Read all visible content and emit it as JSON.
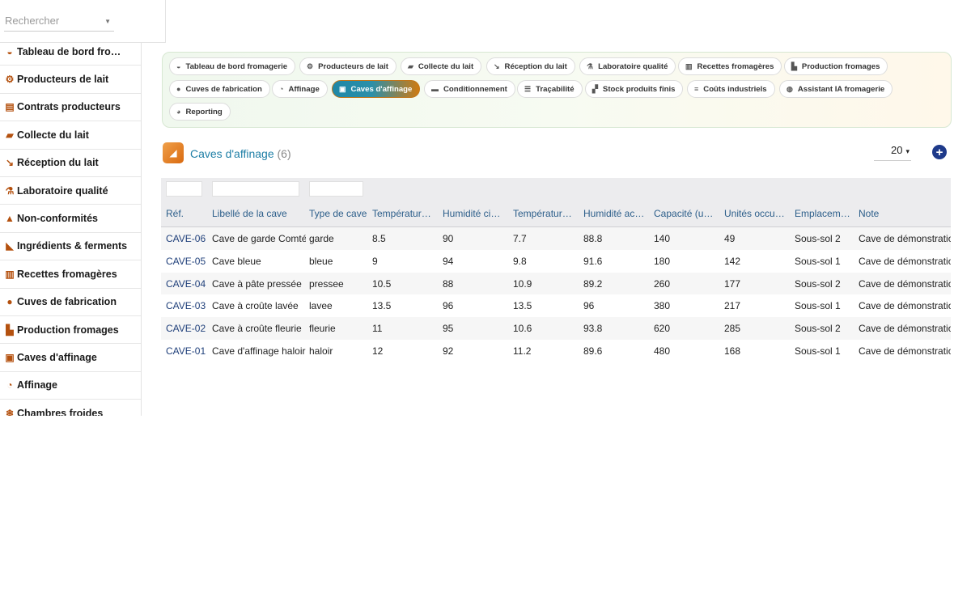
{
  "search": {
    "placeholder": "Rechercher"
  },
  "sidebar": {
    "items": [
      {
        "label": "Tableau de bord fro…",
        "icon": "gauge-icon"
      },
      {
        "label": "Producteurs de lait",
        "icon": "tractor-icon"
      },
      {
        "label": "Contrats producteurs",
        "icon": "file-contract-icon"
      },
      {
        "label": "Collecte du lait",
        "icon": "truck-icon"
      },
      {
        "label": "Réception du lait",
        "icon": "dolly-icon"
      },
      {
        "label": "Laboratoire qualité",
        "icon": "microscope-icon"
      },
      {
        "label": "Non-conformités",
        "icon": "warning-icon"
      },
      {
        "label": "Ingrédients & ferments",
        "icon": "mortar-icon"
      },
      {
        "label": "Recettes fromagères",
        "icon": "book-icon"
      },
      {
        "label": "Cuves de fabrication",
        "icon": "droplet-icon"
      },
      {
        "label": "Production fromages",
        "icon": "industry-icon"
      },
      {
        "label": "Caves d'affinage",
        "icon": "cave-icon"
      },
      {
        "label": "Affinage",
        "icon": "clock-icon"
      },
      {
        "label": "Chambres froides",
        "icon": "snowflake-icon"
      }
    ]
  },
  "tabs": [
    {
      "label": "Tableau de bord fromagerie",
      "icon": "gauge-icon",
      "active": false
    },
    {
      "label": "Producteurs de lait",
      "icon": "tractor-icon",
      "active": false
    },
    {
      "label": "Collecte du lait",
      "icon": "truck-icon",
      "active": false
    },
    {
      "label": "Réception du lait",
      "icon": "dolly-icon",
      "active": false
    },
    {
      "label": "Laboratoire qualité",
      "icon": "microscope-icon",
      "active": false
    },
    {
      "label": "Recettes fromagères",
      "icon": "book-icon",
      "active": false
    },
    {
      "label": "Production fromages",
      "icon": "industry-icon",
      "active": false
    },
    {
      "label": "Cuves de fabrication",
      "icon": "droplet-icon",
      "active": false
    },
    {
      "label": "Affinage",
      "icon": "clock-icon",
      "active": false
    },
    {
      "label": "Caves d'affinage",
      "icon": "cave-icon",
      "active": true
    },
    {
      "label": "Conditionnement",
      "icon": "box-icon",
      "active": false
    },
    {
      "label": "Traçabilité",
      "icon": "barcode-icon",
      "active": false
    },
    {
      "label": "Stock produits finis",
      "icon": "boxes-icon",
      "active": false
    },
    {
      "label": "Coûts industriels",
      "icon": "coins-icon",
      "active": false
    },
    {
      "label": "Assistant IA fromagerie",
      "icon": "brain-icon",
      "active": false
    },
    {
      "label": "Reporting",
      "icon": "chart-pie-icon",
      "active": false
    }
  ],
  "colors": {
    "accent": "#1f7fa6",
    "icon": "#b4510f",
    "active_tab_start": "#1f87a6",
    "active_tab_end": "#cf7a12",
    "add_button": "#1e3a8a"
  },
  "page": {
    "title": "Caves d'affinage",
    "count": "(6)",
    "per_page": "20"
  },
  "table": {
    "headers": [
      "Réf.",
      "Libellé de la cave",
      "Type de cave",
      "Température…",
      "Humidité cibl…",
      "Température…",
      "Humidité act…",
      "Capacité (un…",
      "Unités occup…",
      "Emplacement",
      "Note"
    ],
    "rows": [
      [
        "CAVE-06",
        "Cave de garde Comté",
        "garde",
        "8.5",
        "90",
        "7.7",
        "88.8",
        "140",
        "49",
        "Sous-sol 2",
        "Cave de démonstration"
      ],
      [
        "CAVE-05",
        "Cave bleue",
        "bleue",
        "9",
        "94",
        "9.8",
        "91.6",
        "180",
        "142",
        "Sous-sol 1",
        "Cave de démonstration"
      ],
      [
        "CAVE-04",
        "Cave à pâte pressée",
        "pressee",
        "10.5",
        "88",
        "10.9",
        "89.2",
        "260",
        "177",
        "Sous-sol 2",
        "Cave de démonstration"
      ],
      [
        "CAVE-03",
        "Cave à croûte lavée",
        "lavee",
        "13.5",
        "96",
        "13.5",
        "96",
        "380",
        "217",
        "Sous-sol 1",
        "Cave de démonstration"
      ],
      [
        "CAVE-02",
        "Cave à croûte fleurie",
        "fleurie",
        "11",
        "95",
        "10.6",
        "93.8",
        "620",
        "285",
        "Sous-sol 2",
        "Cave de démonstration"
      ],
      [
        "CAVE-01",
        "Cave d'affinage haloir",
        "haloir",
        "12",
        "92",
        "11.2",
        "89.6",
        "480",
        "168",
        "Sous-sol 1",
        "Cave de démonstration"
      ]
    ]
  }
}
